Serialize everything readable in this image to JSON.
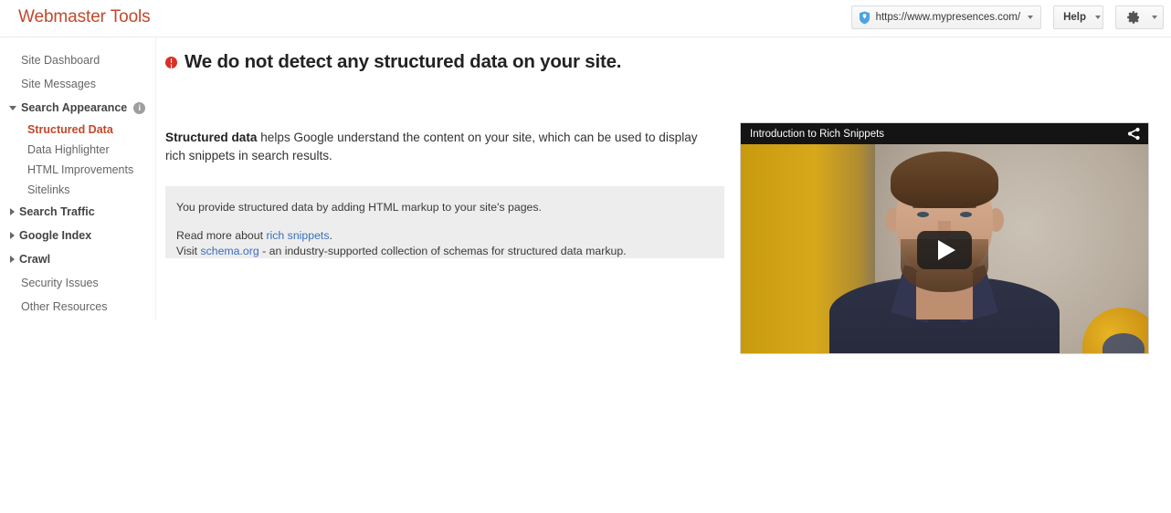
{
  "header": {
    "brand": "Webmaster Tools",
    "site_selector": {
      "icon": "shield-badge-icon",
      "url": "https://www.mypresences.com/"
    },
    "help_label": "Help",
    "settings_icon": "gear-icon"
  },
  "sidebar": {
    "items": [
      {
        "label": "Site Dashboard",
        "type": "item"
      },
      {
        "label": "Site Messages",
        "type": "item"
      },
      {
        "label": "Search Appearance",
        "type": "group",
        "expanded": true,
        "info_icon": "info-icon",
        "info_glyph": "i",
        "children": [
          {
            "label": "Structured Data",
            "active": true
          },
          {
            "label": "Data Highlighter",
            "active": false
          },
          {
            "label": "HTML Improvements",
            "active": false
          },
          {
            "label": "Sitelinks",
            "active": false
          }
        ]
      },
      {
        "label": "Search Traffic",
        "type": "group",
        "expanded": false
      },
      {
        "label": "Google Index",
        "type": "group",
        "expanded": false
      },
      {
        "label": "Crawl",
        "type": "group",
        "expanded": false
      },
      {
        "label": "Security Issues",
        "type": "item"
      },
      {
        "label": "Other Resources",
        "type": "item"
      }
    ]
  },
  "main": {
    "status_icon": "error-icon",
    "title": "We do not detect any structured data on your site.",
    "intro": {
      "bold": "Structured data",
      "rest": " helps Google understand the content on your site, which can be used to display rich snippets in search results."
    },
    "infobox": {
      "line1": "You provide structured data by adding HTML markup to your site's pages.",
      "line2_prefix": "Read more about ",
      "line2_link": "rich snippets",
      "line2_suffix": ".",
      "line3_prefix": "Visit ",
      "line3_link": "schema.org",
      "line3_suffix": " - an industry-supported collection of schemas for structured data markup."
    }
  },
  "video": {
    "title": "Introduction to Rich Snippets",
    "share_icon": "share-icon",
    "play_icon": "play-icon"
  },
  "colors": {
    "brand": "#c1492b",
    "accent_link": "#3b6fbb",
    "error": "#d93025",
    "infobox_bg": "#ededed"
  }
}
